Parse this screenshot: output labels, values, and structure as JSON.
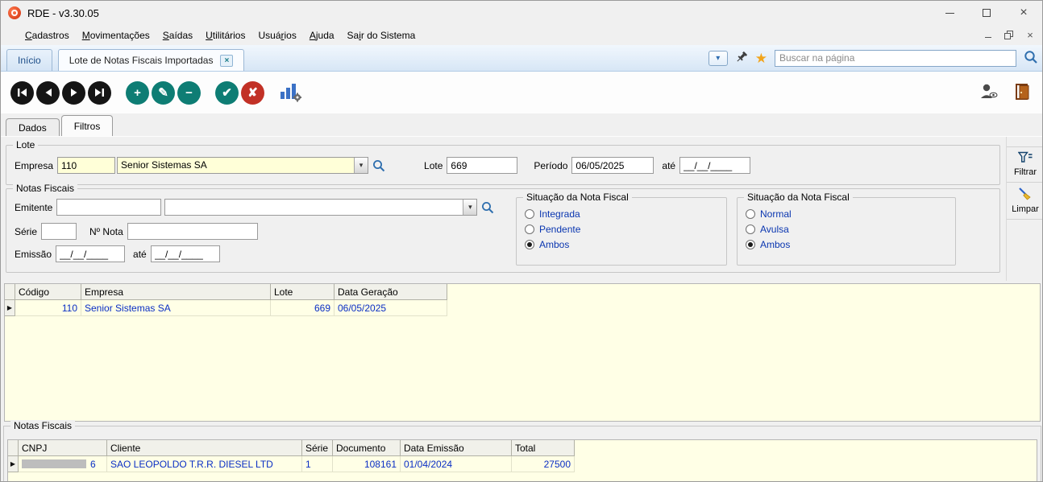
{
  "colors": {
    "accent_blue": "#2e6cb0",
    "grid_text_blue": "#0a2ec4",
    "radio_label_blue": "#0a36b0",
    "field_yellow": "#ffffd8",
    "grid_background": "#ffffe6",
    "toolbar_teal": "#0e7d74",
    "toolbar_red": "#c23126",
    "star_orange": "#f2a41b"
  },
  "window": {
    "title": "RDE - v3.30.05"
  },
  "menu": {
    "items": [
      {
        "pre": "",
        "accel": "C",
        "post": "adastros"
      },
      {
        "pre": "",
        "accel": "M",
        "post": "ovimentações"
      },
      {
        "pre": "",
        "accel": "S",
        "post": "aídas"
      },
      {
        "pre": "",
        "accel": "U",
        "post": "tilitários"
      },
      {
        "pre": "Usuá",
        "accel": "r",
        "post": "ios"
      },
      {
        "pre": "",
        "accel": "A",
        "post": "juda"
      },
      {
        "pre": "Sa",
        "accel": "i",
        "post": "r do Sistema"
      }
    ]
  },
  "tabbar": {
    "home_tab": "Início",
    "active_tab": "Lote de Notas Fiscais Importadas",
    "close_glyph": "×",
    "search_placeholder": "Buscar na página"
  },
  "toolbar": {
    "add": "+",
    "edit": "✎",
    "delete": "−",
    "confirm": "✔",
    "cancel": "✘"
  },
  "page_tabs": {
    "dados": "Dados",
    "filtros": "Filtros"
  },
  "filters": {
    "lote_group": {
      "title": "Lote",
      "empresa_label": "Empresa",
      "empresa_code": "110",
      "empresa_name": "Senior Sistemas SA",
      "lote_label": "Lote",
      "lote_value": "669",
      "periodo_label": "Período",
      "periodo_value": "06/05/2025",
      "ate_label": "até",
      "ate_value": "__/__/____"
    },
    "notas_group": {
      "title": "Notas Fiscais",
      "emitente_label": "Emitente",
      "emitente_code": "",
      "emitente_name": "",
      "serie_label": "Série",
      "serie_value": "",
      "nnota_label": "Nº Nota",
      "nnota_value": "",
      "emissao_label": "Emissão",
      "emissao_value": "__/__/____",
      "ate_label": "até",
      "ate_value": "__/__/____"
    },
    "situacao1": {
      "title": "Situação da Nota Fiscal",
      "options": [
        {
          "label": "Integrada",
          "selected": false
        },
        {
          "label": "Pendente",
          "selected": false
        },
        {
          "label": "Ambos",
          "selected": true
        }
      ]
    },
    "situacao2": {
      "title": "Situação da Nota Fiscal",
      "options": [
        {
          "label": "Normal",
          "selected": false
        },
        {
          "label": "Avulsa",
          "selected": false
        },
        {
          "label": "Ambos",
          "selected": true
        }
      ]
    },
    "filtrar_label": "Filtrar",
    "limpar_label": "Limpar"
  },
  "lotes_grid": {
    "columns": [
      "Código",
      "Empresa",
      "Lote",
      "Data Geração"
    ],
    "row": {
      "codigo": "110",
      "empresa": "Senior Sistemas SA",
      "lote": "669",
      "data_geracao": "06/05/2025"
    }
  },
  "notas_section": {
    "title": "Notas Fiscais",
    "columns": [
      "CNPJ",
      "Cliente",
      "Série",
      "Documento",
      "Data Emissão",
      "Total"
    ],
    "row": {
      "cnpj_redacted": true,
      "cnpj_visible": "6",
      "cliente": "SAO LEOPOLDO T.R.R. DIESEL LTD",
      "serie": "1",
      "documento": "108161",
      "data_emissao": "01/04/2024",
      "total": "27500"
    }
  }
}
